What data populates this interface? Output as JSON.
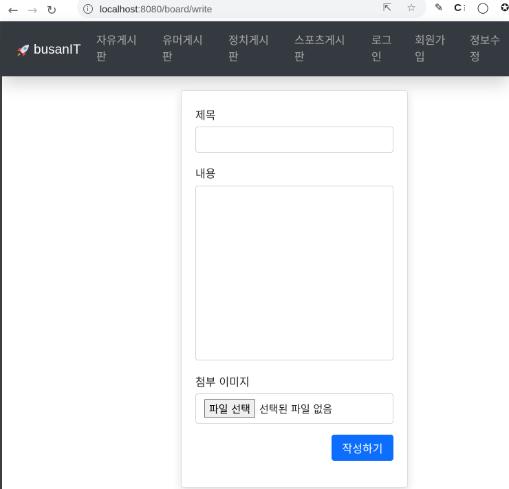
{
  "browser": {
    "url_host": "localhost",
    "url_path": ":8080/board/write"
  },
  "navbar": {
    "brand": "busanIT",
    "items": [
      {
        "line1": "자유게시",
        "line2": "판"
      },
      {
        "line1": "유머게시",
        "line2": "판"
      },
      {
        "line1": "정치게시",
        "line2": "판"
      },
      {
        "line1": "스포츠게시",
        "line2": "판"
      },
      {
        "line1": "로그",
        "line2": "인"
      },
      {
        "line1": "회원가",
        "line2": "입"
      },
      {
        "line1": "정보수",
        "line2": "정"
      }
    ]
  },
  "form": {
    "title_label": "제목",
    "title_value": "",
    "content_label": "내용",
    "content_value": "",
    "image_label": "첨부 이미지",
    "file_button": "파일 선택",
    "file_status": "선택된 파일 없음",
    "submit_label": "작성하기"
  }
}
